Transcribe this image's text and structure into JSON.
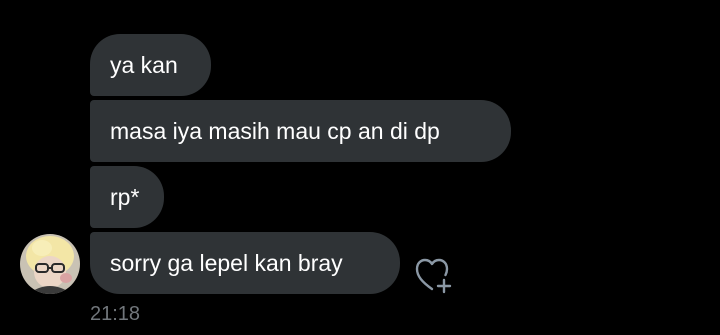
{
  "conversation": {
    "messages": [
      {
        "text": "ya kan"
      },
      {
        "text": "masa iya masih mau cp an di dp"
      },
      {
        "text": "rp*"
      },
      {
        "text": "sorry ga lepel kan bray"
      }
    ],
    "timestamp": "21:18"
  },
  "icons": {
    "avatar": "profile-avatar",
    "react": "heart-plus-icon"
  },
  "colors": {
    "background": "#000000",
    "bubble": "#2f3336",
    "text": "#ffffff",
    "muted": "#71767b"
  }
}
